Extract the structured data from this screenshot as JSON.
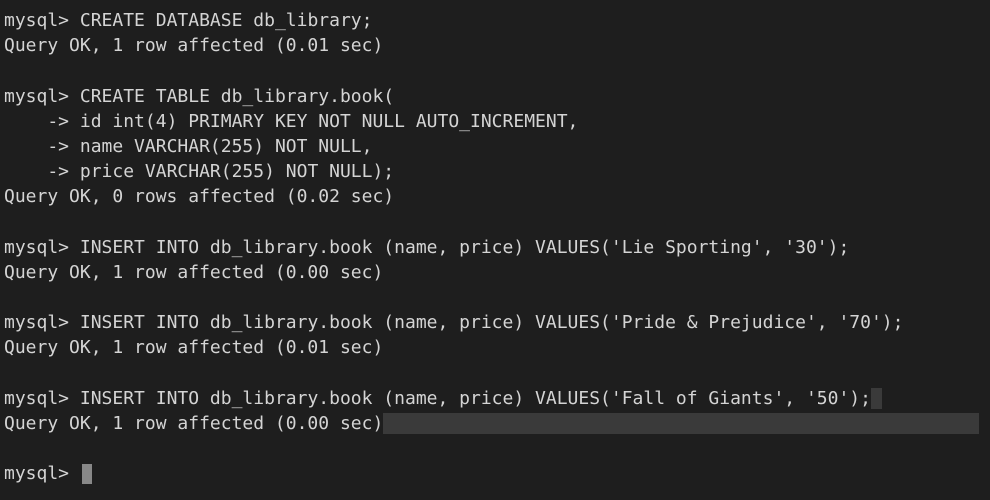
{
  "prompt": "mysql>",
  "cont": "    ->",
  "commands": {
    "c1": "CREATE DATABASE db_library;",
    "r1": "Query OK, 1 row affected (0.01 sec)",
    "c2_l1": "CREATE TABLE db_library.book(",
    "c2_l2": "id int(4) PRIMARY KEY NOT NULL AUTO_INCREMENT,",
    "c2_l3": "name VARCHAR(255) NOT NULL,",
    "c2_l4": "price VARCHAR(255) NOT NULL);",
    "r2": "Query OK, 0 rows affected (0.02 sec)",
    "c3": "INSERT INTO db_library.book (name, price) VALUES('Lie Sporting', '30');",
    "r3": "Query OK, 1 row affected (0.00 sec)",
    "c4": "INSERT INTO db_library.book (name, price) VALUES('Pride & Prejudice', '70');",
    "r4": "Query OK, 1 row affected (0.01 sec)",
    "c5": "INSERT INTO db_library.book (name, price) VALUES('Fall of Giants', '50');",
    "r5": "Query OK, 1 row affected (0.00 sec)"
  }
}
